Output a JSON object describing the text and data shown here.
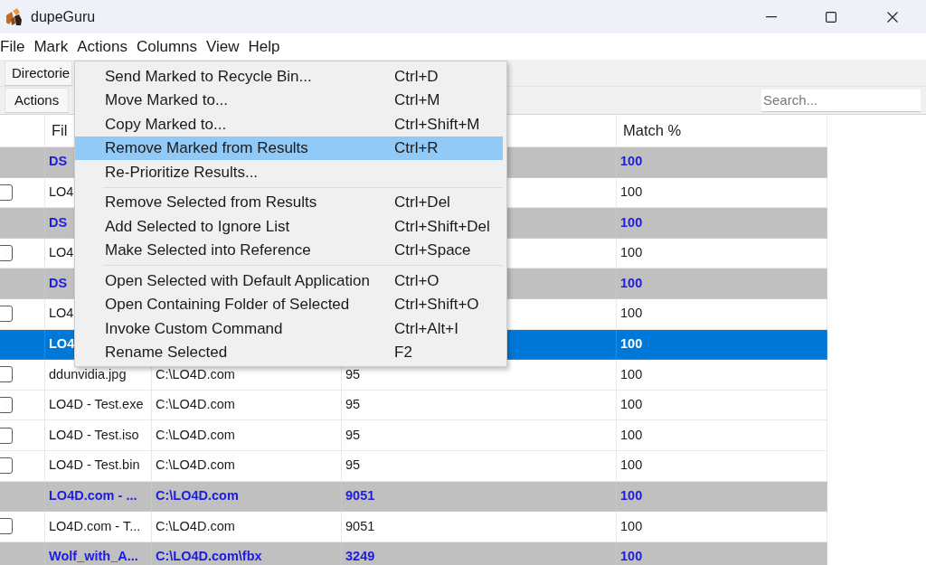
{
  "window": {
    "title": "dupeGuru"
  },
  "menubar": [
    "File",
    "Mark",
    "Actions",
    "Columns",
    "View",
    "Help"
  ],
  "toolbar": {
    "top_button": "Directorie",
    "actions_button": "Actions",
    "search": {
      "placeholder": "Search..."
    }
  },
  "table": {
    "header": {
      "column_1": "Fil",
      "column_4": "Match %"
    },
    "rows": [
      {
        "kind": "group",
        "selected": false,
        "cells": {
          "column_1": "DS",
          "column_4": "100"
        }
      },
      {
        "kind": "dupe",
        "selected": false,
        "checked": false,
        "cells": {
          "column_1": "LO4",
          "column_4": "100"
        }
      },
      {
        "kind": "group",
        "selected": false,
        "cells": {
          "column_1": "DS",
          "column_4": "100"
        }
      },
      {
        "kind": "dupe",
        "selected": false,
        "checked": false,
        "cells": {
          "column_1": "LO4",
          "column_4": "100"
        }
      },
      {
        "kind": "group",
        "selected": false,
        "cells": {
          "column_1": "DS",
          "column_4": "100"
        }
      },
      {
        "kind": "dupe",
        "selected": false,
        "checked": false,
        "cells": {
          "column_1": "LO4",
          "column_4": "100"
        }
      },
      {
        "kind": "group",
        "selected": true,
        "cells": {
          "column_1": "LO4",
          "column_4": "100"
        }
      },
      {
        "kind": "dupe",
        "selected": false,
        "checked": false,
        "cells": {
          "column_1": "ddunvidia.jpg",
          "column_2": "C:\\LO4D.com",
          "column_3": "95",
          "column_4": "100"
        }
      },
      {
        "kind": "dupe",
        "selected": false,
        "checked": false,
        "cells": {
          "column_1": "LO4D - Test.exe",
          "column_2": "C:\\LO4D.com",
          "column_3": "95",
          "column_4": "100"
        }
      },
      {
        "kind": "dupe",
        "selected": false,
        "checked": false,
        "cells": {
          "column_1": "LO4D - Test.iso",
          "column_2": "C:\\LO4D.com",
          "column_3": "95",
          "column_4": "100"
        }
      },
      {
        "kind": "dupe",
        "selected": false,
        "checked": false,
        "cells": {
          "column_1": "LO4D - Test.bin",
          "column_2": "C:\\LO4D.com",
          "column_3": "95",
          "column_4": "100"
        }
      },
      {
        "kind": "group",
        "selected": false,
        "cells": {
          "column_1": "LO4D.com - ...",
          "column_2": "C:\\LO4D.com",
          "column_3": "9051",
          "column_4": "100"
        }
      },
      {
        "kind": "dupe",
        "selected": false,
        "checked": false,
        "cells": {
          "column_1": "LO4D.com - T...",
          "column_2": "C:\\LO4D.com",
          "column_3": "9051",
          "column_4": "100"
        }
      },
      {
        "kind": "group",
        "selected": false,
        "cells": {
          "column_1": "Wolf_with_A...",
          "column_2": "C:\\LO4D.com\\fbx",
          "column_3": "3249",
          "column_4": "100"
        }
      }
    ]
  },
  "actions_menu": {
    "groups": [
      [
        {
          "label": "Send Marked to Recycle Bin...",
          "shortcut": "Ctrl+D",
          "selected": false
        },
        {
          "label": "Move Marked to...",
          "shortcut": "Ctrl+M",
          "selected": false
        },
        {
          "label": "Copy Marked to...",
          "shortcut": "Ctrl+Shift+M",
          "selected": false
        },
        {
          "label": "Remove Marked from Results",
          "shortcut": "Ctrl+R",
          "selected": true
        },
        {
          "label": "Re-Prioritize Results...",
          "selected": false
        }
      ],
      [
        {
          "label": "Remove Selected from Results",
          "shortcut": "Ctrl+Del",
          "selected": false
        },
        {
          "label": "Add Selected to Ignore List",
          "shortcut": "Ctrl+Shift+Del",
          "selected": false
        },
        {
          "label": "Make Selected into Reference",
          "shortcut": "Ctrl+Space",
          "selected": false
        }
      ],
      [
        {
          "label": "Open Selected with Default Application",
          "shortcut": "Ctrl+O",
          "selected": false
        },
        {
          "label": "Open Containing Folder of Selected",
          "shortcut": "Ctrl+Shift+O",
          "selected": false
        },
        {
          "label": "Invoke Custom Command",
          "shortcut": "Ctrl+Alt+I",
          "selected": false
        },
        {
          "label": "Rename Selected",
          "shortcut": "F2",
          "selected": false
        }
      ]
    ]
  }
}
